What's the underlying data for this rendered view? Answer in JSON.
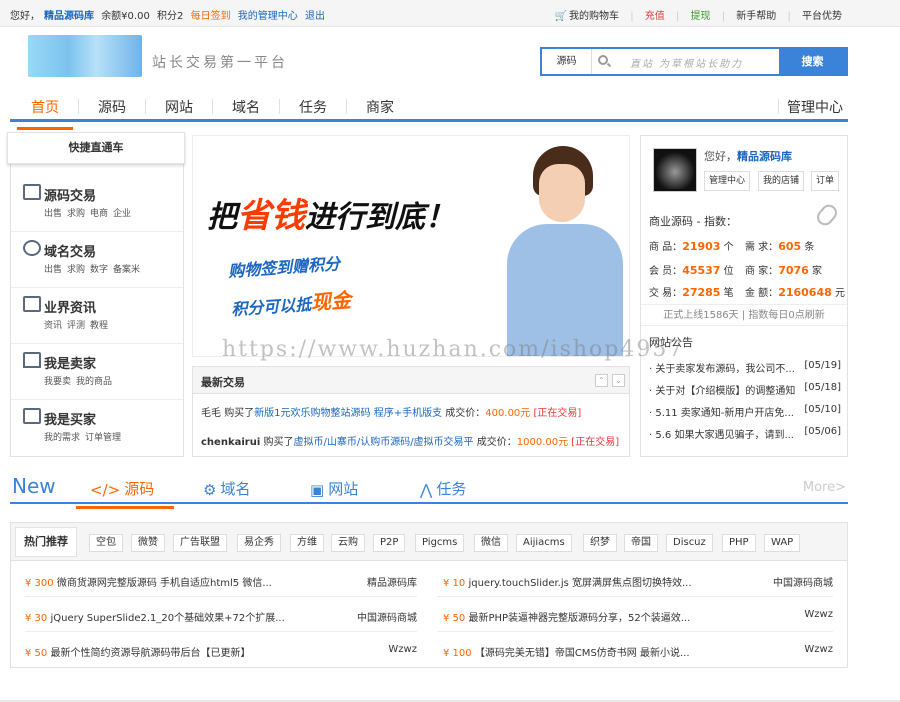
{
  "topbar": {
    "greeting": "您好，",
    "username": "精品源码库",
    "balance": "余额¥0.00",
    "points": "积分2",
    "sign": "每日签到",
    "admin": "我的管理中心",
    "logout": "退出",
    "cart": "我的购物车",
    "recharge": "充值",
    "withdraw": "提现",
    "help": "新手帮助",
    "advantage": "平台优势"
  },
  "header": {
    "slogan": "站长交易第一平台",
    "search_category": "源码",
    "search_placeholder": "直站  为草根站长助力",
    "search_button": "搜索"
  },
  "nav": {
    "items": [
      "首页",
      "源码",
      "网站",
      "域名",
      "任务",
      "商家"
    ],
    "manage": "管理中心"
  },
  "quick": {
    "title": "快捷直通车",
    "items": [
      {
        "title": "源码交易",
        "subs": [
          "出售",
          "求购",
          "电商",
          "企业"
        ]
      },
      {
        "title": "域名交易",
        "subs": [
          "出售",
          "求购",
          "数字",
          "备案米"
        ]
      },
      {
        "title": "业界资讯",
        "subs": [
          "资讯",
          "评测",
          "教程"
        ]
      },
      {
        "title": "我是卖家",
        "subs": [
          "我要卖",
          "我的商品"
        ]
      },
      {
        "title": "我是买家",
        "subs": [
          "我的需求",
          "订单管理"
        ]
      }
    ]
  },
  "banner": {
    "line1_a": "把",
    "line1_b": "省钱",
    "line1_c": "进行到底！",
    "line2": "购物签到赠积分",
    "line3_a": "积分可以抵",
    "line3_b": "现金"
  },
  "trades": {
    "title": "最新交易",
    "rows": [
      {
        "user": "毛毛",
        "action": "购买了",
        "item": "新版1元欢乐购物整站源码 程序+手机版支",
        "deal": "成交价：",
        "price": "400.00元",
        "status": "[正在交易]"
      },
      {
        "user": "chenkairui",
        "action": "购买了",
        "item": "虚拟币/山寨币/认购币源码/虚拟币交易平",
        "deal": "成交价：",
        "price": "1000.00元",
        "status": "[正在交易]"
      }
    ]
  },
  "user": {
    "hello": "您好，",
    "name": "精品源码库",
    "buttons": [
      "管理中心",
      "我的店铺",
      "订单"
    ],
    "stats_title": "商业源码 - 指数：",
    "stats": [
      {
        "label": "商 品：",
        "value": "21903",
        "unit": "个"
      },
      {
        "label": "需 求：",
        "value": "605",
        "unit": "条"
      },
      {
        "label": "会 员：",
        "value": "45537",
        "unit": "位"
      },
      {
        "label": "商 家：",
        "value": "7076",
        "unit": "家"
      },
      {
        "label": "交 易：",
        "value": "27285",
        "unit": "笔"
      },
      {
        "label": "金 额：",
        "value": "2160648",
        "unit": "元"
      }
    ],
    "online": "正式上线1586天 | 指数每日0点刷新",
    "notice_title": "网站公告",
    "notices": [
      {
        "text": "· 关于卖家发布源码，我公司不...",
        "date": "[05/19]"
      },
      {
        "text": "· 关于对【介绍模版】的调整通知",
        "date": "[05/18]"
      },
      {
        "text": "· 5.11 卖家通知-新用户开店免...",
        "date": "[05/10]"
      },
      {
        "text": "· 5.6 如果大家遇见骗子，请到...",
        "date": "[05/06]"
      }
    ]
  },
  "watermark": "https://www.huzhan.com/ishop4957",
  "tabs": {
    "new": "New",
    "items": [
      "源码",
      "域名",
      "网站",
      "任务"
    ],
    "more": "More>"
  },
  "hot": {
    "title": "热门推荐",
    "tags": [
      "空包",
      "微赞",
      "广告联盟",
      "易企秀",
      "方维",
      "云购",
      "P2P",
      "Pigcms",
      "微信",
      "Aijiacms",
      "织梦",
      "帝国",
      "Discuz",
      "PHP",
      "WAP"
    ],
    "items": [
      {
        "price": "¥ 300",
        "title": "微商货源网完整版源码 手机自适应html5 微信...",
        "seller": "精品源码库"
      },
      {
        "price": "¥ 10",
        "title": "jquery.touchSlider.js 宽屏满屏焦点图切换特效...",
        "seller": "中国源码商城"
      },
      {
        "price": "¥ 30",
        "title": "jQuery SuperSlide2.1_20个基础效果+72个扩展...",
        "seller": "中国源码商城"
      },
      {
        "price": "¥ 50",
        "title": "最新PHP装逼神器完整版源码分享，52个装逼效...",
        "seller": "Wzwz"
      },
      {
        "price": "¥ 50",
        "title": "最新个性简约资源导航源码带后台【已更新】",
        "seller": "Wzwz"
      },
      {
        "price": "¥ 100",
        "title": "【源码完美无错】帝国CMS仿奇书网 最新小说...",
        "seller": "Wzwz"
      }
    ]
  },
  "colors": {
    "accent": "#3b83d8",
    "orange": "#ff6600",
    "red": "#e4393c"
  }
}
